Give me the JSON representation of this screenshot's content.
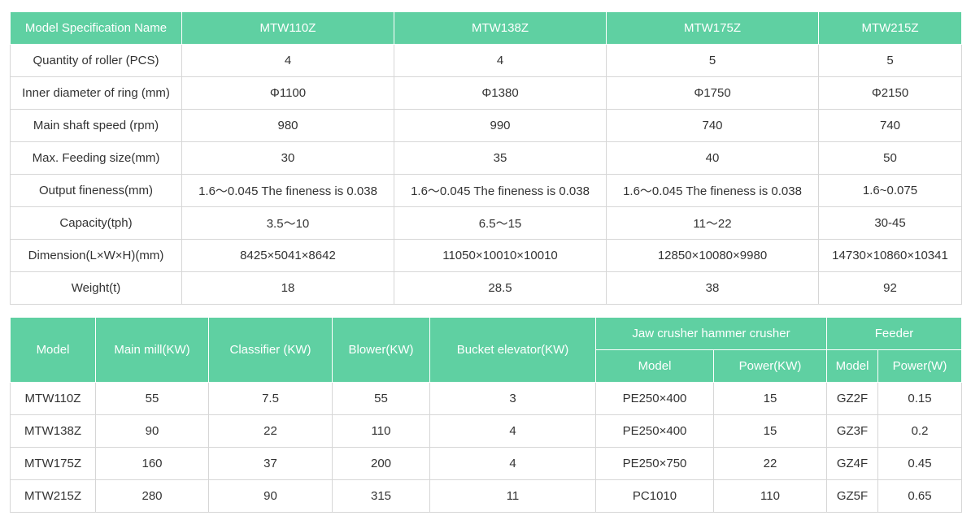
{
  "spec_table": {
    "header": [
      "Model Specification Name",
      "MTW110Z",
      "MTW138Z",
      "MTW175Z",
      "MTW215Z"
    ],
    "rows": [
      [
        "Quantity of roller (PCS)",
        "4",
        "4",
        "5",
        "5"
      ],
      [
        "Inner diameter of ring (mm)",
        "Φ1100",
        "Φ1380",
        "Φ1750",
        "Φ2150"
      ],
      [
        "Main shaft speed (rpm)",
        "980",
        "990",
        "740",
        "740"
      ],
      [
        "Max. Feeding size(mm)",
        "30",
        "35",
        "40",
        "50"
      ],
      [
        "Output fineness(mm)",
        "1.6～0.045 The fineness is 0.038",
        "1.6～0.045 The fineness is 0.038",
        "1.6～0.045 The fineness is 0.038",
        "1.6~0.075"
      ],
      [
        "Capacity(tph)",
        "3.5～10",
        "6.5～15",
        "11～22",
        "30-45"
      ],
      [
        "Dimension(L×W×H)(mm)",
        "8425×5041×8642",
        "11050×10010×10010",
        "12850×10080×9980",
        "14730×10860×10341"
      ],
      [
        "Weight(t)",
        "18",
        "28.5",
        "38",
        "92"
      ]
    ]
  },
  "power_table": {
    "header_top": [
      "Model",
      "Main mill(KW)",
      "Classifier (KW)",
      "Blower(KW)",
      "Bucket elevator(KW)",
      "Jaw crusher hammer crusher",
      "Feeder"
    ],
    "header_sub": [
      "Model",
      "Power(KW)",
      "Model",
      "Power(W)"
    ],
    "rows": [
      [
        "MTW110Z",
        "55",
        "7.5",
        "55",
        "3",
        "PE250×400",
        "15",
        "GZ2F",
        "0.15"
      ],
      [
        "MTW138Z",
        "90",
        "22",
        "110",
        "4",
        "PE250×400",
        "15",
        "GZ3F",
        "0.2"
      ],
      [
        "MTW175Z",
        "160",
        "37",
        "200",
        "4",
        "PE250×750",
        "22",
        "GZ4F",
        "0.45"
      ],
      [
        "MTW215Z",
        "280",
        "90",
        "315",
        "11",
        "PC1010",
        "110",
        "GZ5F",
        "0.65"
      ]
    ]
  },
  "colors": {
    "header_bg": "#5fd0a2",
    "header_text": "#ffffff",
    "border": "#d6d6d6",
    "text": "#333333"
  }
}
